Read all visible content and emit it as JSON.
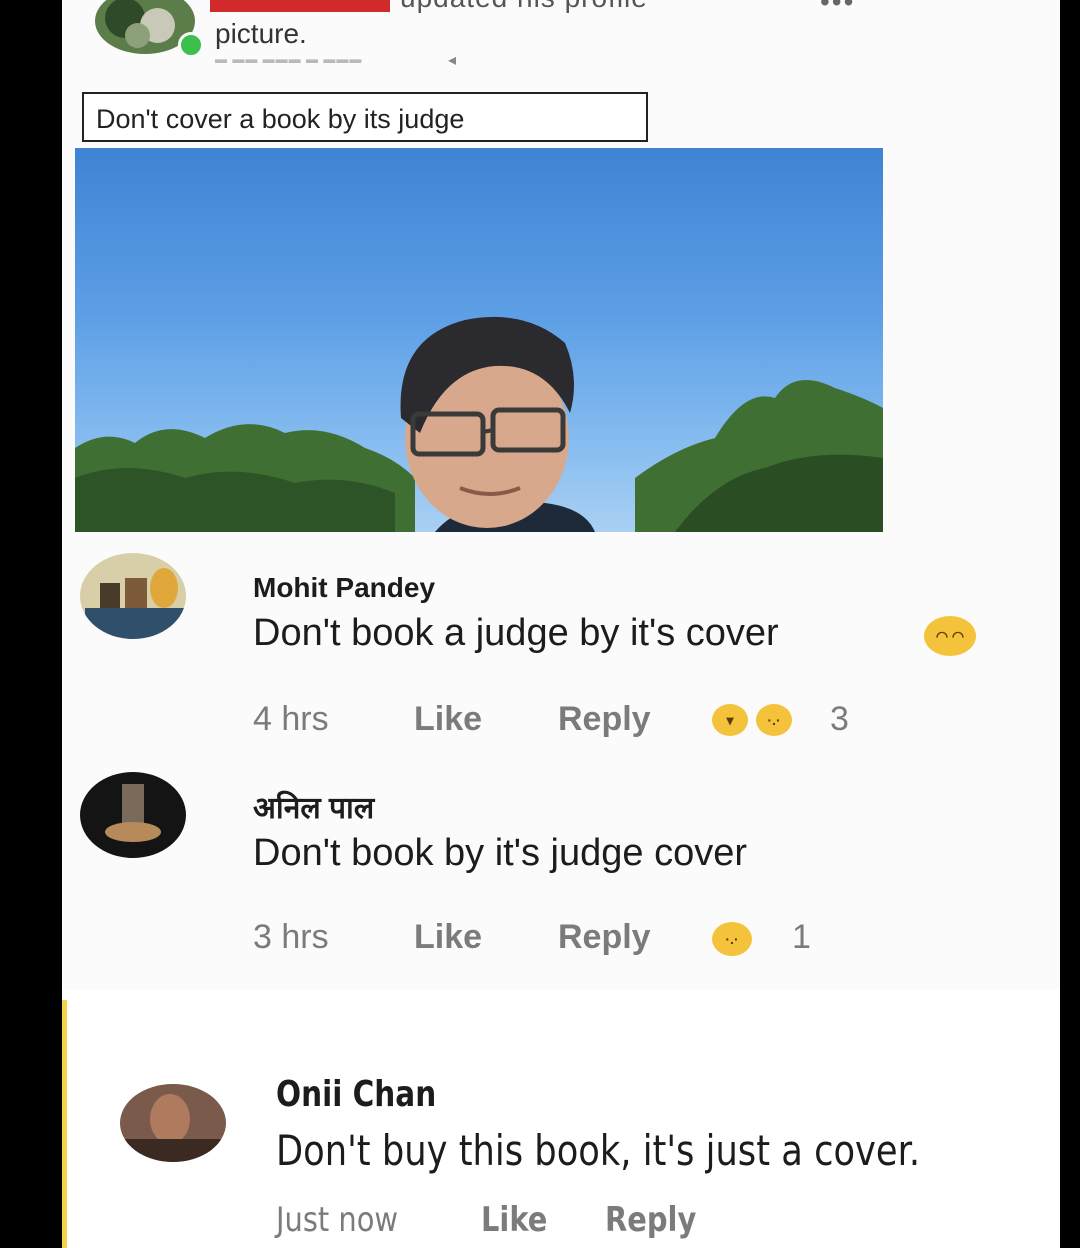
{
  "post": {
    "header_text": "updated his profile",
    "picture_word": "picture.",
    "caption": "Don't cover a book by its judge",
    "more_icon": "more-dots-icon"
  },
  "comments": [
    {
      "name": "Mohit Pandey",
      "text": "Don't book a judge by it's cover",
      "time": "4 hrs",
      "like": "Like",
      "reply": "Reply",
      "reactions": [
        "haha-emoji",
        "sad-emoji"
      ],
      "reaction_count": "3",
      "inline_emoji": "upside-down-face-emoji"
    },
    {
      "name": "अनिल पाल",
      "text": "Don't book by it's judge cover",
      "time": "3 hrs",
      "like": "Like",
      "reply": "Reply",
      "reactions": [
        "sad-emoji"
      ],
      "reaction_count": "1"
    },
    {
      "name": "Onii Chan",
      "text": "Don't buy this book, it's just a cover.",
      "time": "Just now",
      "like": "Like",
      "reply": "Reply"
    }
  ],
  "colors": {
    "online": "#3dbf4e",
    "reaction": "#f5c33b",
    "meta_text": "#7b7b7b"
  }
}
